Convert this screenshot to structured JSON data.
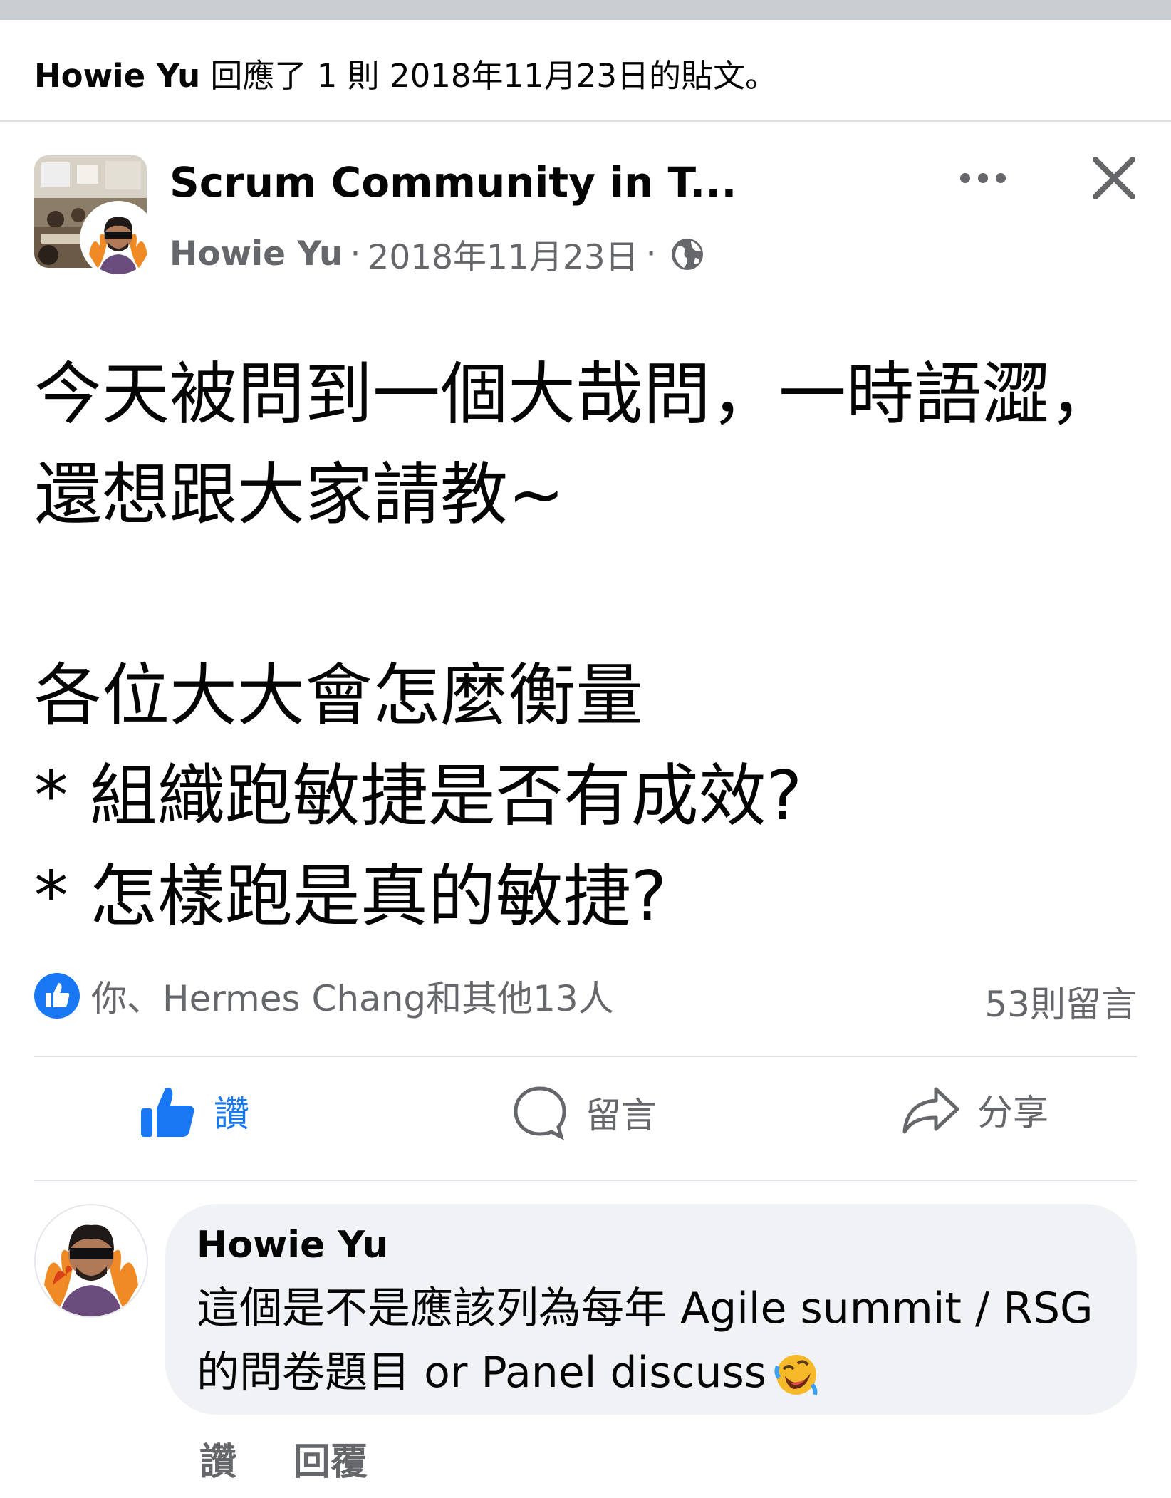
{
  "activity": {
    "actor": "Howie Yu",
    "text": "回應了 1 則 2018年11月23日的貼文。"
  },
  "post": {
    "group_name": "Scrum Community in T...",
    "author": "Howie Yu",
    "date": "2018年11月23日",
    "separator": "·",
    "privacy_icon": "globe-icon",
    "body_lines": [
      "今天被問到一個大哉問，一時語澀，",
      "還想跟大家請教~",
      "",
      "各位大大會怎麼衡量",
      "* 組織跑敏捷是否有成效?",
      "* 怎樣跑是真的敏捷?"
    ],
    "reactions_text": "你、Hermes Chang和其他13人",
    "comment_count": "53則留言"
  },
  "actions": {
    "like": "讚",
    "comment": "留言",
    "share": "分享"
  },
  "comment": {
    "author": "Howie Yu",
    "lines": [
      "這個是不是應該列為每年 Agile summit / RSG",
      "的問卷題目 or Panel discuss"
    ],
    "emoji": "rofl-emoji",
    "like_label": "讚",
    "reply_label": "回覆"
  },
  "colors": {
    "facebook_blue": "#1877f2",
    "secondary_text": "#65676b",
    "bubble_bg": "#f0f2f5",
    "divider": "#dcdfe3"
  }
}
